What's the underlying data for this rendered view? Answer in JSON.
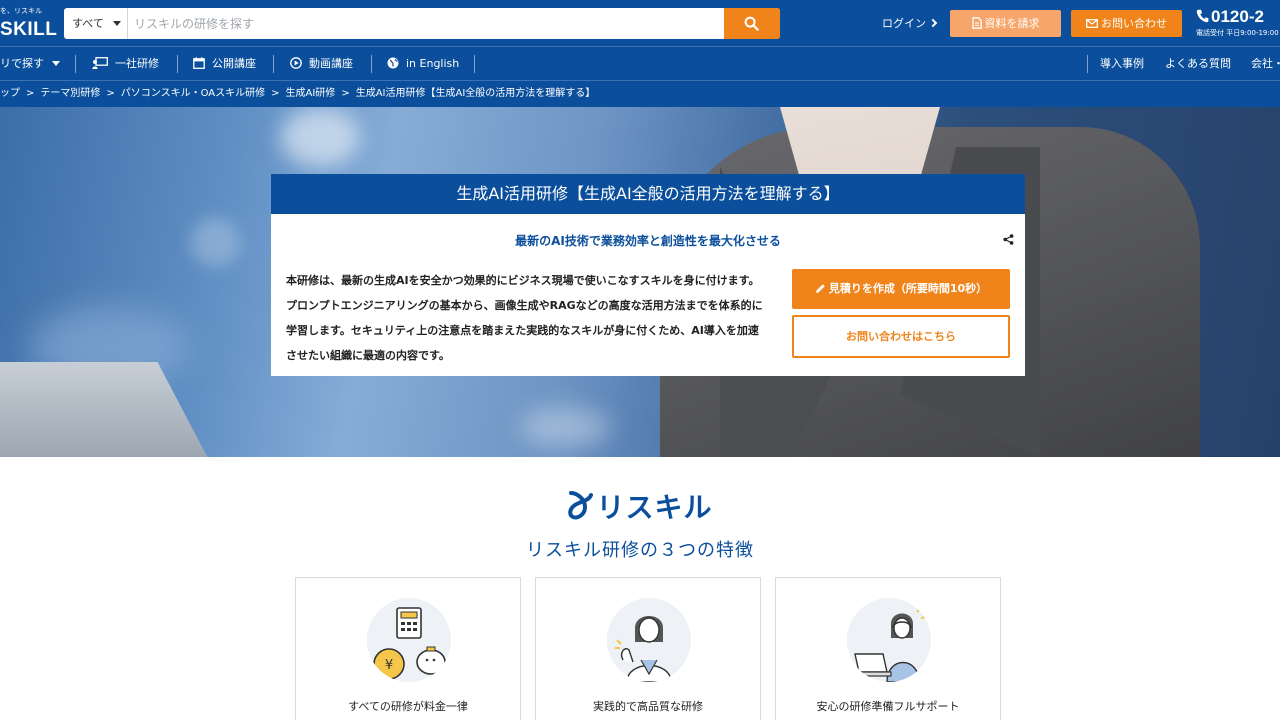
{
  "header": {
    "logo_tagline": "を、リスキル",
    "logo_text": "SKILL",
    "search_scope": "すべて",
    "search_placeholder": "リスキルの研修を探す",
    "login_label": "ログイン",
    "doc_request_label": "資料を請求",
    "contact_label": "お問い合わせ",
    "phone_number": "0120-2",
    "phone_hours": "電話受付 平日9:00-19:00"
  },
  "nav": {
    "items": [
      {
        "label": "リで探す",
        "icon": "caret-down-icon"
      },
      {
        "label": "一社研修",
        "icon": "chalkboard-teacher-icon"
      },
      {
        "label": "公開講座",
        "icon": "calendar-icon"
      },
      {
        "label": "動画講座",
        "icon": "play-circle-icon"
      },
      {
        "label": "in English",
        "icon": "globe-icon"
      }
    ],
    "right_items": [
      "導入事例",
      "よくある質問",
      "会社・"
    ]
  },
  "breadcrumb": [
    "ップ",
    "テーマ別研修",
    "パソコンスキル・OAスキル研修",
    "生成AI研修",
    "生成AI活用研修【生成AI全般の活用方法を理解する】"
  ],
  "hero": {
    "title": "生成AI活用研修【生成AI全般の活用方法を理解する】",
    "subtitle": "最新のAI技術で業務効率と創造性を最大化させる",
    "description": "本研修は、最新の生成AIを安全かつ効果的にビジネス現場で使いこなすスキルを身に付けます。プロンプトエンジニアリングの基本から、画像生成やRAGなどの高度な活用方法までを体系的に学習します。セキュリティ上の注意点を踏まえた実践的なスキルが身に付くため、AI導入を加速させたい組織に最適の内容です。",
    "estimate_button": "見積りを作成（所要時間10秒）",
    "contact_button": "お問い合わせはこちら"
  },
  "features": {
    "brand": "リスキル",
    "title": "リスキル研修の３つの特徴",
    "cards": [
      {
        "label": "すべての研修が料金一律",
        "icon": "calculator-piggy-bank-icon"
      },
      {
        "label": "実践的で高品質な研修",
        "icon": "instructor-woman-icon"
      },
      {
        "label": "安心の研修準備フルサポート",
        "icon": "support-laptop-woman-icon"
      }
    ]
  },
  "colors": {
    "brand_blue": "#0b4f9c",
    "accent_orange": "#f0831a",
    "light_orange": "#f6a66a"
  }
}
